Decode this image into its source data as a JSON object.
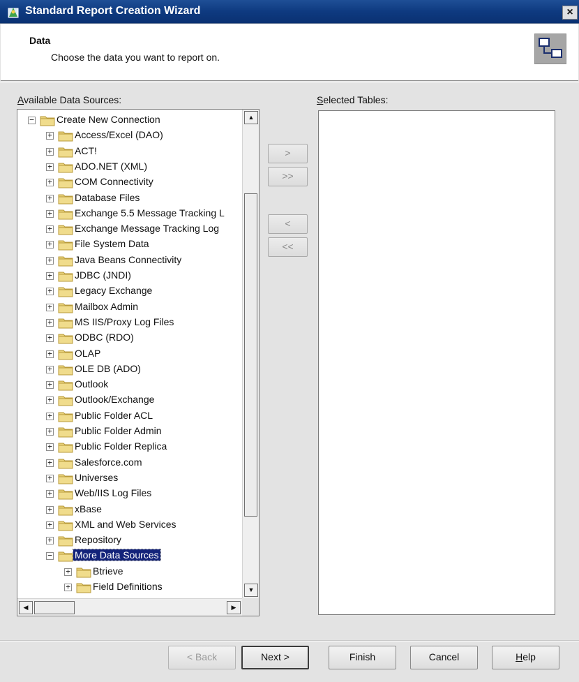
{
  "window": {
    "title": "Standard Report Creation Wizard",
    "close_label": "×"
  },
  "header": {
    "title": "Data",
    "subtitle": "Choose the data you want to report on."
  },
  "labels": {
    "available_prefix": "A",
    "available_rest": "vailable Data Sources:",
    "selected_prefix": "S",
    "selected_rest": "elected Tables:"
  },
  "tree": {
    "root": "Create New Connection",
    "items": [
      "Access/Excel (DAO)",
      "ACT!",
      "ADO.NET (XML)",
      "COM Connectivity",
      "Database Files",
      "Exchange 5.5 Message Tracking L",
      "Exchange Message Tracking Log",
      "File System Data",
      "Java Beans Connectivity",
      "JDBC (JNDI)",
      "Legacy Exchange",
      "Mailbox Admin",
      "MS IIS/Proxy Log Files",
      "ODBC (RDO)",
      "OLAP",
      "OLE DB (ADO)",
      "Outlook",
      "Outlook/Exchange",
      "Public Folder ACL",
      "Public Folder Admin",
      "Public Folder Replica",
      "Salesforce.com",
      "Universes",
      "Web/IIS Log Files",
      "xBase",
      "XML and Web Services",
      "Repository"
    ],
    "more": "More Data Sources",
    "sub_items": [
      "Btrieve",
      "Field Definitions"
    ],
    "expand_symbol": "+",
    "collapse_symbol": "−"
  },
  "scroll": {
    "up": "▲",
    "down": "▼",
    "left": "◀",
    "right": "▶"
  },
  "transfer_buttons": {
    "add": ">",
    "add_all": ">>",
    "remove": "<",
    "remove_all": "<<"
  },
  "buttons": {
    "back": "< Back",
    "next": "Next >",
    "finish": "Finish",
    "cancel": "Cancel",
    "help_prefix": "H",
    "help_rest": "elp"
  },
  "colors": {
    "titlebar": "#0e3a80",
    "folder": "#e9d27a",
    "selection": "#13237a"
  }
}
